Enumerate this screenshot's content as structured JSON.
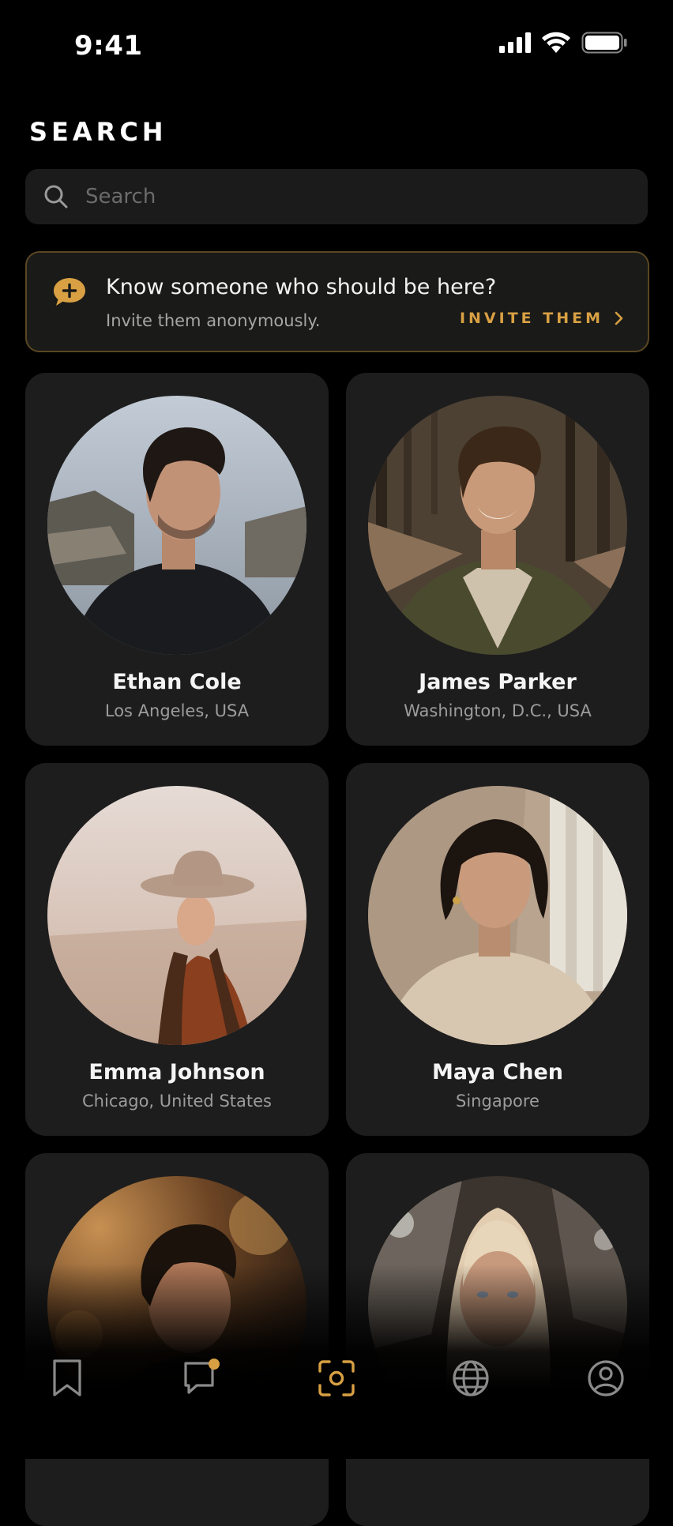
{
  "status_bar": {
    "time": "9:41"
  },
  "header": {
    "title": "SEARCH"
  },
  "search": {
    "placeholder": "Search",
    "value": ""
  },
  "invite": {
    "headline": "Know someone who should be here?",
    "subtext": "Invite them anonymously.",
    "cta": "INVITE THEM"
  },
  "profiles": [
    {
      "name": "Ethan Cole",
      "location": "Los Angeles, USA"
    },
    {
      "name": "James Parker",
      "location": "Washington, D.C., USA"
    },
    {
      "name": "Emma Johnson",
      "location": "Chicago, United States"
    },
    {
      "name": "Maya Chen",
      "location": "Singapore"
    },
    {
      "name": "",
      "location": ""
    },
    {
      "name": "",
      "location": ""
    }
  ],
  "nav": {
    "items": [
      {
        "icon": "bookmark-icon",
        "active": false
      },
      {
        "icon": "chat-icon",
        "active": false,
        "badge": true
      },
      {
        "icon": "scan-icon",
        "active": true
      },
      {
        "icon": "globe-icon",
        "active": false
      },
      {
        "icon": "profile-icon",
        "active": false
      }
    ]
  },
  "colors": {
    "accent": "#d8a043",
    "background": "#000000",
    "card": "#1d1d1d",
    "nav_inactive": "#8a8a8a"
  }
}
